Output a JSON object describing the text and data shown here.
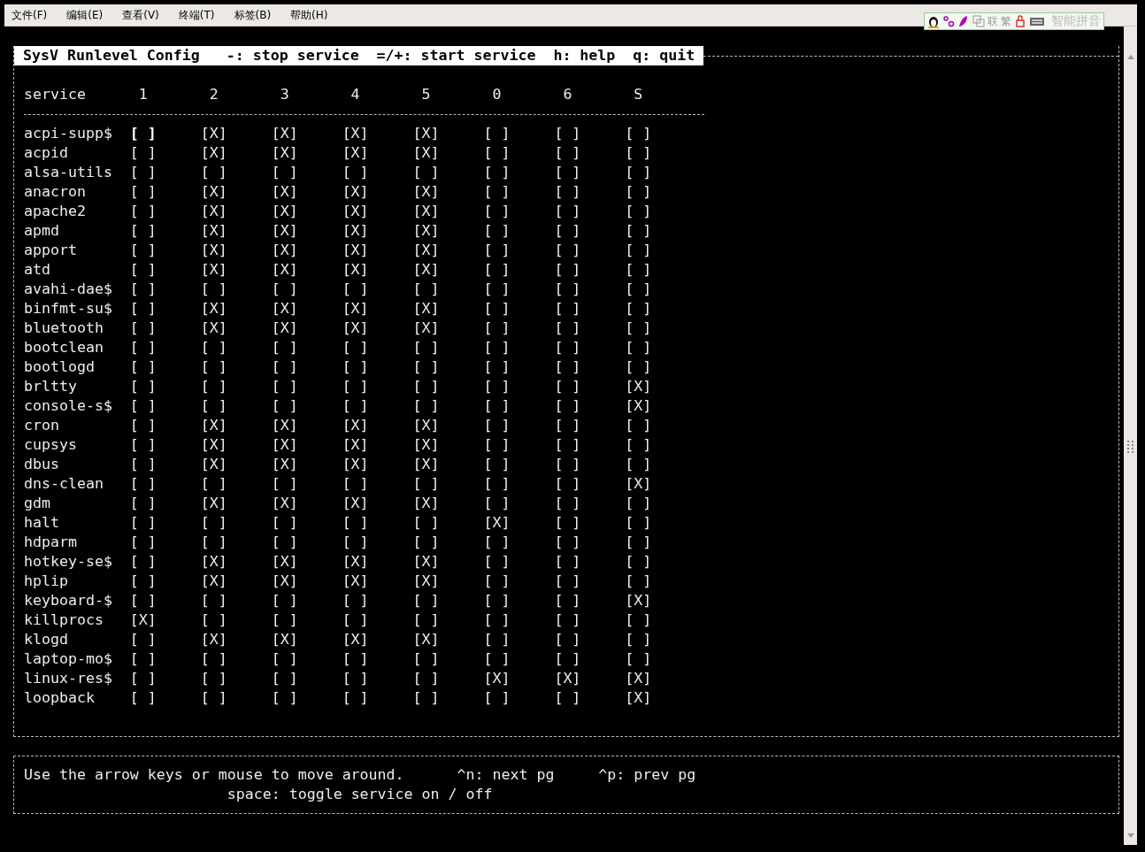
{
  "menu_bar": [
    "文件(F)",
    "编辑(E)",
    "查看(V)",
    "终端(T)",
    "标签(B)",
    "帮助(H)"
  ],
  "ime_toolbar": {
    "items": [
      "联",
      "繁"
    ],
    "label": "智能拼音"
  },
  "header": {
    "title": "SysV Runlevel Config",
    "hints": [
      "-: stop service",
      "=/+: start service",
      "h: help",
      "q: quit"
    ]
  },
  "table": {
    "name_header": "service",
    "columns": [
      "1",
      "2",
      "3",
      "4",
      "5",
      "0",
      "6",
      "S"
    ],
    "rows": [
      {
        "service": "acpi-supp$",
        "cells": [
          {
            "text": "[ ]",
            "selected": true
          },
          {
            "text": "[X]",
            "selected": false
          },
          {
            "text": "[X]",
            "selected": false
          },
          {
            "text": "[X]",
            "selected": false
          },
          {
            "text": "[X]",
            "selected": false
          },
          {
            "text": "[ ]",
            "selected": false
          },
          {
            "text": "[ ]",
            "selected": false
          },
          {
            "text": "[ ]",
            "selected": false
          }
        ]
      },
      {
        "service": "acpid",
        "cells": [
          {
            "text": "[ ]",
            "selected": false
          },
          {
            "text": "[X]",
            "selected": false
          },
          {
            "text": "[X]",
            "selected": false
          },
          {
            "text": "[X]",
            "selected": false
          },
          {
            "text": "[X]",
            "selected": false
          },
          {
            "text": "[ ]",
            "selected": false
          },
          {
            "text": "[ ]",
            "selected": false
          },
          {
            "text": "[ ]",
            "selected": false
          }
        ]
      },
      {
        "service": "alsa-utils",
        "cells": [
          {
            "text": "[ ]",
            "selected": false
          },
          {
            "text": "[ ]",
            "selected": false
          },
          {
            "text": "[ ]",
            "selected": false
          },
          {
            "text": "[ ]",
            "selected": false
          },
          {
            "text": "[ ]",
            "selected": false
          },
          {
            "text": "[ ]",
            "selected": false
          },
          {
            "text": "[ ]",
            "selected": false
          },
          {
            "text": "[ ]",
            "selected": false
          }
        ]
      },
      {
        "service": "anacron",
        "cells": [
          {
            "text": "[ ]",
            "selected": false
          },
          {
            "text": "[X]",
            "selected": false
          },
          {
            "text": "[X]",
            "selected": false
          },
          {
            "text": "[X]",
            "selected": false
          },
          {
            "text": "[X]",
            "selected": false
          },
          {
            "text": "[ ]",
            "selected": false
          },
          {
            "text": "[ ]",
            "selected": false
          },
          {
            "text": "[ ]",
            "selected": false
          }
        ]
      },
      {
        "service": "apache2",
        "cells": [
          {
            "text": "[ ]",
            "selected": false
          },
          {
            "text": "[X]",
            "selected": false
          },
          {
            "text": "[X]",
            "selected": false
          },
          {
            "text": "[X]",
            "selected": false
          },
          {
            "text": "[X]",
            "selected": false
          },
          {
            "text": "[ ]",
            "selected": false
          },
          {
            "text": "[ ]",
            "selected": false
          },
          {
            "text": "[ ]",
            "selected": false
          }
        ]
      },
      {
        "service": "apmd",
        "cells": [
          {
            "text": "[ ]",
            "selected": false
          },
          {
            "text": "[X]",
            "selected": false
          },
          {
            "text": "[X]",
            "selected": false
          },
          {
            "text": "[X]",
            "selected": false
          },
          {
            "text": "[X]",
            "selected": false
          },
          {
            "text": "[ ]",
            "selected": false
          },
          {
            "text": "[ ]",
            "selected": false
          },
          {
            "text": "[ ]",
            "selected": false
          }
        ]
      },
      {
        "service": "apport",
        "cells": [
          {
            "text": "[ ]",
            "selected": false
          },
          {
            "text": "[X]",
            "selected": false
          },
          {
            "text": "[X]",
            "selected": false
          },
          {
            "text": "[X]",
            "selected": false
          },
          {
            "text": "[X]",
            "selected": false
          },
          {
            "text": "[ ]",
            "selected": false
          },
          {
            "text": "[ ]",
            "selected": false
          },
          {
            "text": "[ ]",
            "selected": false
          }
        ]
      },
      {
        "service": "atd",
        "cells": [
          {
            "text": "[ ]",
            "selected": false
          },
          {
            "text": "[X]",
            "selected": false
          },
          {
            "text": "[X]",
            "selected": false
          },
          {
            "text": "[X]",
            "selected": false
          },
          {
            "text": "[X]",
            "selected": false
          },
          {
            "text": "[ ]",
            "selected": false
          },
          {
            "text": "[ ]",
            "selected": false
          },
          {
            "text": "[ ]",
            "selected": false
          }
        ]
      },
      {
        "service": "avahi-dae$",
        "cells": [
          {
            "text": "[ ]",
            "selected": false
          },
          {
            "text": "[ ]",
            "selected": false
          },
          {
            "text": "[ ]",
            "selected": false
          },
          {
            "text": "[ ]",
            "selected": false
          },
          {
            "text": "[ ]",
            "selected": false
          },
          {
            "text": "[ ]",
            "selected": false
          },
          {
            "text": "[ ]",
            "selected": false
          },
          {
            "text": "[ ]",
            "selected": false
          }
        ]
      },
      {
        "service": "binfmt-su$",
        "cells": [
          {
            "text": "[ ]",
            "selected": false
          },
          {
            "text": "[X]",
            "selected": false
          },
          {
            "text": "[X]",
            "selected": false
          },
          {
            "text": "[X]",
            "selected": false
          },
          {
            "text": "[X]",
            "selected": false
          },
          {
            "text": "[ ]",
            "selected": false
          },
          {
            "text": "[ ]",
            "selected": false
          },
          {
            "text": "[ ]",
            "selected": false
          }
        ]
      },
      {
        "service": "bluetooth",
        "cells": [
          {
            "text": "[ ]",
            "selected": false
          },
          {
            "text": "[X]",
            "selected": false
          },
          {
            "text": "[X]",
            "selected": false
          },
          {
            "text": "[X]",
            "selected": false
          },
          {
            "text": "[X]",
            "selected": false
          },
          {
            "text": "[ ]",
            "selected": false
          },
          {
            "text": "[ ]",
            "selected": false
          },
          {
            "text": "[ ]",
            "selected": false
          }
        ]
      },
      {
        "service": "bootclean",
        "cells": [
          {
            "text": "[ ]",
            "selected": false
          },
          {
            "text": "[ ]",
            "selected": false
          },
          {
            "text": "[ ]",
            "selected": false
          },
          {
            "text": "[ ]",
            "selected": false
          },
          {
            "text": "[ ]",
            "selected": false
          },
          {
            "text": "[ ]",
            "selected": false
          },
          {
            "text": "[ ]",
            "selected": false
          },
          {
            "text": "[ ]",
            "selected": false
          }
        ]
      },
      {
        "service": "bootlogd",
        "cells": [
          {
            "text": "[ ]",
            "selected": false
          },
          {
            "text": "[ ]",
            "selected": false
          },
          {
            "text": "[ ]",
            "selected": false
          },
          {
            "text": "[ ]",
            "selected": false
          },
          {
            "text": "[ ]",
            "selected": false
          },
          {
            "text": "[ ]",
            "selected": false
          },
          {
            "text": "[ ]",
            "selected": false
          },
          {
            "text": "[ ]",
            "selected": false
          }
        ]
      },
      {
        "service": "brltty",
        "cells": [
          {
            "text": "[ ]",
            "selected": false
          },
          {
            "text": "[ ]",
            "selected": false
          },
          {
            "text": "[ ]",
            "selected": false
          },
          {
            "text": "[ ]",
            "selected": false
          },
          {
            "text": "[ ]",
            "selected": false
          },
          {
            "text": "[ ]",
            "selected": false
          },
          {
            "text": "[ ]",
            "selected": false
          },
          {
            "text": "[X]",
            "selected": false
          }
        ]
      },
      {
        "service": "console-s$",
        "cells": [
          {
            "text": "[ ]",
            "selected": false
          },
          {
            "text": "[ ]",
            "selected": false
          },
          {
            "text": "[ ]",
            "selected": false
          },
          {
            "text": "[ ]",
            "selected": false
          },
          {
            "text": "[ ]",
            "selected": false
          },
          {
            "text": "[ ]",
            "selected": false
          },
          {
            "text": "[ ]",
            "selected": false
          },
          {
            "text": "[X]",
            "selected": false
          }
        ]
      },
      {
        "service": "cron",
        "cells": [
          {
            "text": "[ ]",
            "selected": false
          },
          {
            "text": "[X]",
            "selected": false
          },
          {
            "text": "[X]",
            "selected": false
          },
          {
            "text": "[X]",
            "selected": false
          },
          {
            "text": "[X]",
            "selected": false
          },
          {
            "text": "[ ]",
            "selected": false
          },
          {
            "text": "[ ]",
            "selected": false
          },
          {
            "text": "[ ]",
            "selected": false
          }
        ]
      },
      {
        "service": "cupsys",
        "cells": [
          {
            "text": "[ ]",
            "selected": false
          },
          {
            "text": "[X]",
            "selected": false
          },
          {
            "text": "[X]",
            "selected": false
          },
          {
            "text": "[X]",
            "selected": false
          },
          {
            "text": "[X]",
            "selected": false
          },
          {
            "text": "[ ]",
            "selected": false
          },
          {
            "text": "[ ]",
            "selected": false
          },
          {
            "text": "[ ]",
            "selected": false
          }
        ]
      },
      {
        "service": "dbus",
        "cells": [
          {
            "text": "[ ]",
            "selected": false
          },
          {
            "text": "[X]",
            "selected": false
          },
          {
            "text": "[X]",
            "selected": false
          },
          {
            "text": "[X]",
            "selected": false
          },
          {
            "text": "[X]",
            "selected": false
          },
          {
            "text": "[ ]",
            "selected": false
          },
          {
            "text": "[ ]",
            "selected": false
          },
          {
            "text": "[ ]",
            "selected": false
          }
        ]
      },
      {
        "service": "dns-clean",
        "cells": [
          {
            "text": "[ ]",
            "selected": false
          },
          {
            "text": "[ ]",
            "selected": false
          },
          {
            "text": "[ ]",
            "selected": false
          },
          {
            "text": "[ ]",
            "selected": false
          },
          {
            "text": "[ ]",
            "selected": false
          },
          {
            "text": "[ ]",
            "selected": false
          },
          {
            "text": "[ ]",
            "selected": false
          },
          {
            "text": "[X]",
            "selected": false
          }
        ]
      },
      {
        "service": "gdm",
        "cells": [
          {
            "text": "[ ]",
            "selected": false
          },
          {
            "text": "[X]",
            "selected": false
          },
          {
            "text": "[X]",
            "selected": false
          },
          {
            "text": "[X]",
            "selected": false
          },
          {
            "text": "[X]",
            "selected": false
          },
          {
            "text": "[ ]",
            "selected": false
          },
          {
            "text": "[ ]",
            "selected": false
          },
          {
            "text": "[ ]",
            "selected": false
          }
        ]
      },
      {
        "service": "halt",
        "cells": [
          {
            "text": "[ ]",
            "selected": false
          },
          {
            "text": "[ ]",
            "selected": false
          },
          {
            "text": "[ ]",
            "selected": false
          },
          {
            "text": "[ ]",
            "selected": false
          },
          {
            "text": "[ ]",
            "selected": false
          },
          {
            "text": "[X]",
            "selected": false
          },
          {
            "text": "[ ]",
            "selected": false
          },
          {
            "text": "[ ]",
            "selected": false
          }
        ]
      },
      {
        "service": "hdparm",
        "cells": [
          {
            "text": "[ ]",
            "selected": false
          },
          {
            "text": "[ ]",
            "selected": false
          },
          {
            "text": "[ ]",
            "selected": false
          },
          {
            "text": "[ ]",
            "selected": false
          },
          {
            "text": "[ ]",
            "selected": false
          },
          {
            "text": "[ ]",
            "selected": false
          },
          {
            "text": "[ ]",
            "selected": false
          },
          {
            "text": "[ ]",
            "selected": false
          }
        ]
      },
      {
        "service": "hotkey-se$",
        "cells": [
          {
            "text": "[ ]",
            "selected": false
          },
          {
            "text": "[X]",
            "selected": false
          },
          {
            "text": "[X]",
            "selected": false
          },
          {
            "text": "[X]",
            "selected": false
          },
          {
            "text": "[X]",
            "selected": false
          },
          {
            "text": "[ ]",
            "selected": false
          },
          {
            "text": "[ ]",
            "selected": false
          },
          {
            "text": "[ ]",
            "selected": false
          }
        ]
      },
      {
        "service": "hplip",
        "cells": [
          {
            "text": "[ ]",
            "selected": false
          },
          {
            "text": "[X]",
            "selected": false
          },
          {
            "text": "[X]",
            "selected": false
          },
          {
            "text": "[X]",
            "selected": false
          },
          {
            "text": "[X]",
            "selected": false
          },
          {
            "text": "[ ]",
            "selected": false
          },
          {
            "text": "[ ]",
            "selected": false
          },
          {
            "text": "[ ]",
            "selected": false
          }
        ]
      },
      {
        "service": "keyboard-$",
        "cells": [
          {
            "text": "[ ]",
            "selected": false
          },
          {
            "text": "[ ]",
            "selected": false
          },
          {
            "text": "[ ]",
            "selected": false
          },
          {
            "text": "[ ]",
            "selected": false
          },
          {
            "text": "[ ]",
            "selected": false
          },
          {
            "text": "[ ]",
            "selected": false
          },
          {
            "text": "[ ]",
            "selected": false
          },
          {
            "text": "[X]",
            "selected": false
          }
        ]
      },
      {
        "service": "killprocs",
        "cells": [
          {
            "text": "[X]",
            "selected": false
          },
          {
            "text": "[ ]",
            "selected": false
          },
          {
            "text": "[ ]",
            "selected": false
          },
          {
            "text": "[ ]",
            "selected": false
          },
          {
            "text": "[ ]",
            "selected": false
          },
          {
            "text": "[ ]",
            "selected": false
          },
          {
            "text": "[ ]",
            "selected": false
          },
          {
            "text": "[ ]",
            "selected": false
          }
        ]
      },
      {
        "service": "klogd",
        "cells": [
          {
            "text": "[ ]",
            "selected": false
          },
          {
            "text": "[X]",
            "selected": false
          },
          {
            "text": "[X]",
            "selected": false
          },
          {
            "text": "[X]",
            "selected": false
          },
          {
            "text": "[X]",
            "selected": false
          },
          {
            "text": "[ ]",
            "selected": false
          },
          {
            "text": "[ ]",
            "selected": false
          },
          {
            "text": "[ ]",
            "selected": false
          }
        ]
      },
      {
        "service": "laptop-mo$",
        "cells": [
          {
            "text": "[ ]",
            "selected": false
          },
          {
            "text": "[ ]",
            "selected": false
          },
          {
            "text": "[ ]",
            "selected": false
          },
          {
            "text": "[ ]",
            "selected": false
          },
          {
            "text": "[ ]",
            "selected": false
          },
          {
            "text": "[ ]",
            "selected": false
          },
          {
            "text": "[ ]",
            "selected": false
          },
          {
            "text": "[ ]",
            "selected": false
          }
        ]
      },
      {
        "service": "linux-res$",
        "cells": [
          {
            "text": "[ ]",
            "selected": false
          },
          {
            "text": "[ ]",
            "selected": false
          },
          {
            "text": "[ ]",
            "selected": false
          },
          {
            "text": "[ ]",
            "selected": false
          },
          {
            "text": "[ ]",
            "selected": false
          },
          {
            "text": "[X]",
            "selected": false
          },
          {
            "text": "[X]",
            "selected": false
          },
          {
            "text": "[X]",
            "selected": false
          }
        ]
      },
      {
        "service": "loopback",
        "cells": [
          {
            "text": "[ ]",
            "selected": false
          },
          {
            "text": "[ ]",
            "selected": false
          },
          {
            "text": "[ ]",
            "selected": false
          },
          {
            "text": "[ ]",
            "selected": false
          },
          {
            "text": "[ ]",
            "selected": false
          },
          {
            "text": "[ ]",
            "selected": false
          },
          {
            "text": "[ ]",
            "selected": false
          },
          {
            "text": "[X]",
            "selected": false
          }
        ]
      }
    ]
  },
  "footer": {
    "line_1": [
      "Use the arrow keys or mouse to move around.",
      "^n: next pg",
      "^p: prev pg"
    ],
    "line_2": "space: toggle service on / off"
  }
}
